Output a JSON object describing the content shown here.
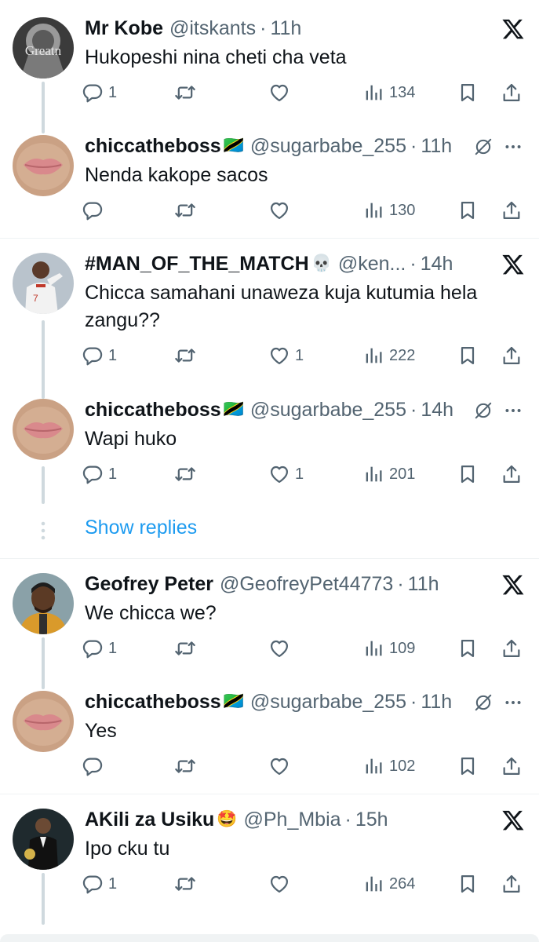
{
  "tweets": [
    {
      "name": "Mr Kobe",
      "emoji": "",
      "handle": "@itskants",
      "sep": "·",
      "time": "11h",
      "text": "Hukopeshi nina cheti cha veta",
      "replies": "1",
      "retweets": "",
      "likes": "",
      "views": "134",
      "corner": "x-logo"
    },
    {
      "name": "chiccatheboss",
      "emoji": "🇹🇿",
      "handle": "@sugarbabe_255",
      "sep": "·",
      "time": "11h",
      "text": "Nenda kakope sacos",
      "replies": "",
      "retweets": "",
      "likes": "",
      "views": "130",
      "corner": "mute-more"
    },
    {
      "name": "#MAN_OF_THE_MATCH",
      "emoji": "💀",
      "handle": "@ken...",
      "sep": "·",
      "time": "14h",
      "text": "Chicca samahani unaweza kuja kutumia hela zangu??",
      "replies": "1",
      "retweets": "",
      "likes": "1",
      "views": "222",
      "corner": "x-logo"
    },
    {
      "name": "chiccatheboss",
      "emoji": "🇹🇿",
      "handle": "@sugarbabe_255",
      "sep": "·",
      "time": "14h",
      "text": "Wapi huko",
      "replies": "1",
      "retweets": "",
      "likes": "1",
      "views": "201",
      "corner": "mute-more"
    },
    {
      "name": "Geofrey Peter",
      "emoji": "",
      "handle": "@GeofreyPet44773",
      "sep": "·",
      "time": "11h",
      "text": "We chicca we?",
      "replies": "1",
      "retweets": "",
      "likes": "",
      "views": "109",
      "corner": "x-logo"
    },
    {
      "name": "chiccatheboss",
      "emoji": "🇹🇿",
      "handle": "@sugarbabe_255",
      "sep": "·",
      "time": "11h",
      "text": "Yes",
      "replies": "",
      "retweets": "",
      "likes": "",
      "views": "102",
      "corner": "mute-more"
    },
    {
      "name": "AKili za Usiku",
      "emoji": "🤩",
      "handle": "@Ph_Mbia",
      "sep": "·",
      "time": "15h",
      "text": "Ipo cku tu",
      "replies": "1",
      "retweets": "",
      "likes": "",
      "views": "264",
      "corner": "x-logo"
    }
  ],
  "show_replies": "Show replies",
  "avatar_text": {
    "mr_kobe": "Greatn"
  },
  "colors": {
    "text": "#0f1419",
    "secondary": "#536471",
    "link": "#1d9bf0",
    "thread_line": "#cfd9de",
    "divider": "#eff3f4"
  }
}
